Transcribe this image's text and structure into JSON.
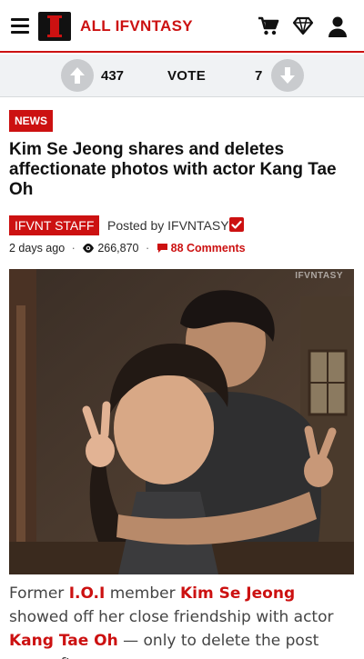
{
  "header": {
    "brand": "ALL IFVNTASY",
    "icons": [
      "menu-icon",
      "logo-icon",
      "cart-icon",
      "diamond-icon",
      "user-icon"
    ]
  },
  "vote": {
    "up_count": "437",
    "label": "VOTE",
    "down_count": "7"
  },
  "article": {
    "category": "NEWS",
    "title": "Kim Se Jeong shares and deletes affectionate photos with actor Kang Tae Oh",
    "author_badge": "IFVNT STAFF",
    "posted_by": "Posted by IFVNTASY",
    "time_ago": "2 days ago",
    "views": "266,870",
    "comments": "88 Comments",
    "image_watermark": "IFVNTASY",
    "body": {
      "p1": "Former ",
      "link1": "I.O.I",
      "p2": " member ",
      "link2": "Kim Se Jeong",
      "p3": " showed off her close friendship with actor ",
      "link3": "Kang Tae Oh",
      "p4": " — only to delete the post soon after."
    }
  },
  "colors": {
    "accent": "#cc1111",
    "votebar_bg": "#f0f2f4",
    "arrow_circle": "#c9cbce"
  }
}
